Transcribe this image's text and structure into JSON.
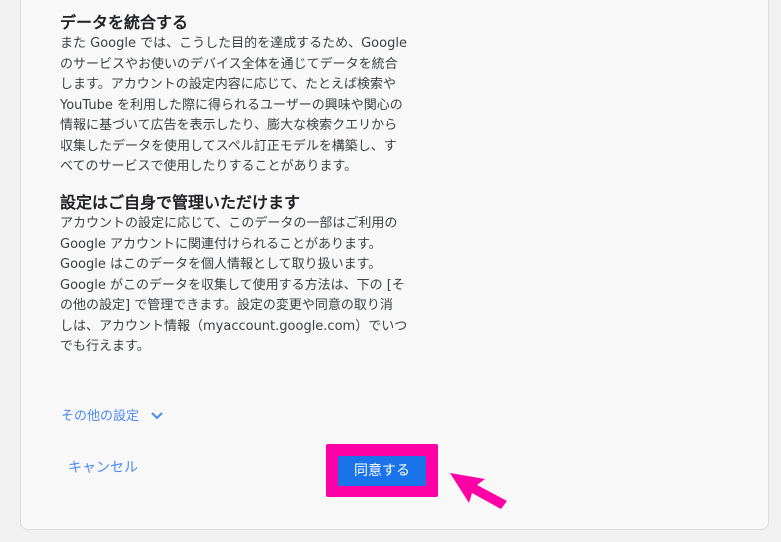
{
  "section_integrate": {
    "title": "データを統合する",
    "body": "また Google では、こうした目的を達成するため、Google\nのサービスやお使いのデバイス全体を通じてデータを統合\nします。アカウントの設定内容に応じて、たとえば検索や\nYouTube を利用した際に得られるユーザーの興味や関心の\n情報に基づいて広告を表示したり、膨大な検索クエリから\n収集したデータを使用してスペル訂正モデルを構築し、す\nべてのサービスで使用したりすることがあります。"
  },
  "section_control": {
    "title": "設定はご自身で管理いただけます",
    "body": "アカウントの設定に応じて、このデータの一部はご利用の\nGoogle アカウントに関連付けられることがあります。\nGoogle はこのデータを個人情報として取り扱います。\nGoogle がこのデータを収集して使用する方法は、下の [そ\nの他の設定] で管理できます。設定の変更や同意の取り消\nしは、アカウント情報（myaccount.google.com）でいつ\nでも行えます。"
  },
  "more_settings": {
    "label": "その他の設定",
    "icon": "chevron-down-icon"
  },
  "actions": {
    "cancel_label": "キャンセル",
    "agree_label": "同意する"
  },
  "colors": {
    "link": "#4a8af4",
    "primary_button": "#1a73e8",
    "highlight": "#ff00a6"
  },
  "annotation": {
    "icon": "pointer-arrow-icon"
  }
}
